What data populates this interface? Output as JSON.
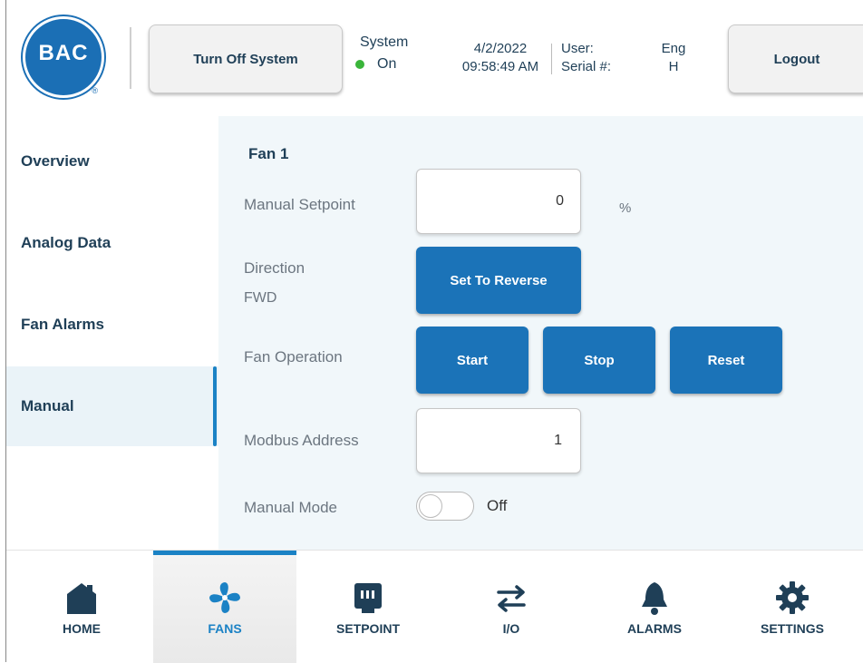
{
  "header": {
    "logo_text": "BAC",
    "logo_reg": "®",
    "turn_off_label": "Turn Off System",
    "system_label": "System",
    "system_status": "On",
    "date": "4/2/2022",
    "time": "09:58:49 AM",
    "user_label": "User:",
    "user_value": "Eng",
    "serial_label": "Serial #:",
    "serial_value": "H",
    "logout_label": "Logout",
    "status_color": "#3ab53a"
  },
  "sidebar": {
    "items": [
      {
        "label": "Overview"
      },
      {
        "label": "Analog Data"
      },
      {
        "label": "Fan Alarms"
      },
      {
        "label": "Manual",
        "active": true
      }
    ]
  },
  "main": {
    "title": "Fan 1",
    "manual_setpoint": {
      "label": "Manual Setpoint",
      "value": "0",
      "unit": "%"
    },
    "direction": {
      "label": "Direction",
      "value": "FWD",
      "button": "Set To Reverse"
    },
    "fan_operation": {
      "label": "Fan Operation",
      "start": "Start",
      "stop": "Stop",
      "reset": "Reset"
    },
    "modbus_address": {
      "label": "Modbus Address",
      "value": "1"
    },
    "manual_mode": {
      "label": "Manual Mode",
      "state": "Off"
    }
  },
  "nav": {
    "items": [
      {
        "label": "HOME",
        "icon": "home-icon"
      },
      {
        "label": "FANS",
        "icon": "fan-icon",
        "active": true
      },
      {
        "label": "SETPOINT",
        "icon": "setpoint-icon"
      },
      {
        "label": "I/O",
        "icon": "io-arrows-icon"
      },
      {
        "label": "ALARMS",
        "icon": "bell-icon"
      },
      {
        "label": "SETTINGS",
        "icon": "gear-icon"
      }
    ]
  },
  "colors": {
    "accent": "#1b82c5",
    "button_blue": "#1b73b8",
    "text_dark": "#1f3f57",
    "panel_bg": "#f1f7fa"
  }
}
